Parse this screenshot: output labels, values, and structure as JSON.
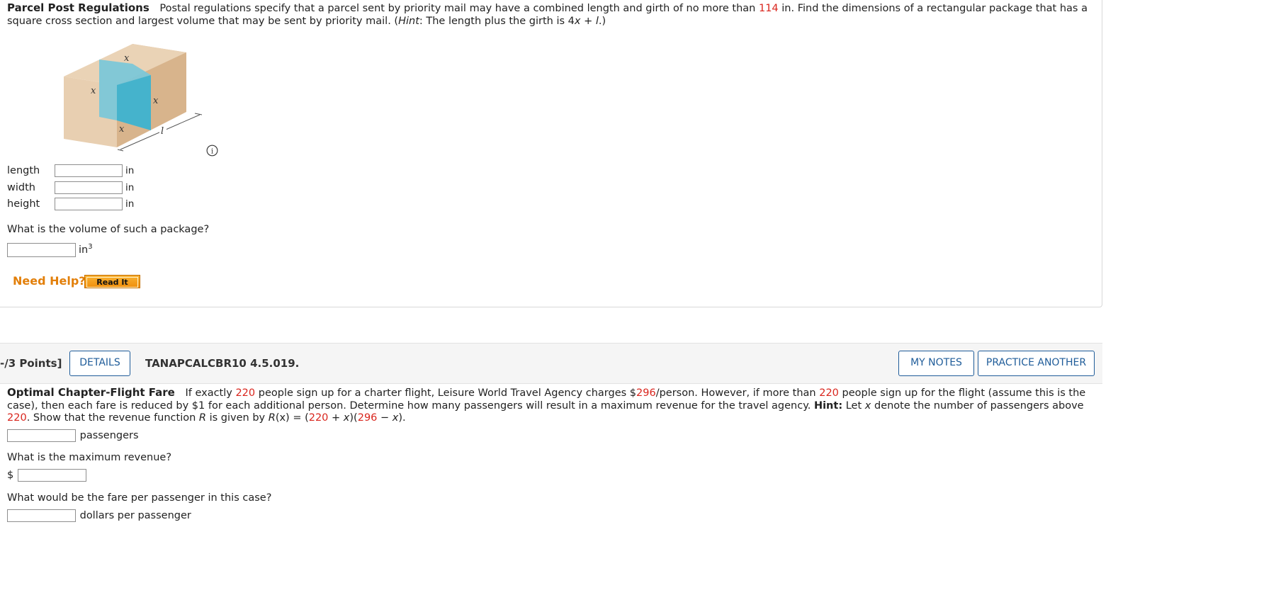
{
  "q1": {
    "title": "Parcel Post Regulations",
    "text_a": "Postal regulations specify that a parcel sent by priority mail may have a combined length and girth of no more than ",
    "limit": "114",
    "text_b": " in. Find the dimensions of a rectangular package that has a square cross section and largest volume that may be sent by priority mail. (",
    "hint_word": "Hint",
    "text_c": ": The length plus the girth is 4",
    "x_var": "x",
    "text_d": " + ",
    "l_var": "l",
    "text_e": ".)",
    "figure": {
      "label_x": "x",
      "label_l": "l",
      "colors": {
        "box_front": "#e6c9a8",
        "box_side": "#d9b690",
        "cross_section": "#7cc7d8"
      }
    },
    "fields": [
      {
        "label": "length",
        "unit": "in",
        "value": ""
      },
      {
        "label": "width",
        "unit": "in",
        "value": ""
      },
      {
        "label": "height",
        "unit": "in",
        "value": ""
      }
    ],
    "volume_question": "What is the volume of such a package?",
    "volume_unit": "in",
    "volume_exp": "3",
    "need_help": "Need Help?",
    "read_it": "Read It"
  },
  "q2": {
    "points": "-/3 Points]",
    "details": "DETAILS",
    "qid": "TANAPCALCBR10 4.5.019.",
    "my_notes": "MY NOTES",
    "practice": "PRACTICE ANOTHER",
    "title": "Optimal Chapter-Flight Fare",
    "t1": "If exactly ",
    "n220": "220",
    "t2": " people sign up for a charter flight, Leisure World Travel Agency charges $",
    "n296": "296",
    "t3": "/person. However, if more than ",
    "t4": " people sign up for the flight (assume this is the case), then each fare is reduced by $1 for each additional person. Determine how many passengers will result in a maximum revenue for the travel agency. ",
    "hint_label": "Hint:",
    "t5": " Let ",
    "x_var": "x",
    "t6": " denote the number of passengers above ",
    "t7": ". Show that the revenue function ",
    "r_var": "R",
    "t8": " is given by ",
    "formula_r": "R",
    "formula_a": "(x) = (",
    "formula_b": " + ",
    "formula_x1": "x",
    "formula_c": ")(",
    "formula_d": " − ",
    "formula_x2": "x",
    "formula_e": ").",
    "passengers_unit": "passengers",
    "max_rev_q": "What is the maximum revenue?",
    "dollar": "$",
    "fare_q": "What would be the fare per passenger in this case?",
    "fare_unit": "dollars per passenger"
  },
  "accent": "#1f5c99",
  "highlight_red": "#d9251d",
  "help_orange": "#e27f0a"
}
